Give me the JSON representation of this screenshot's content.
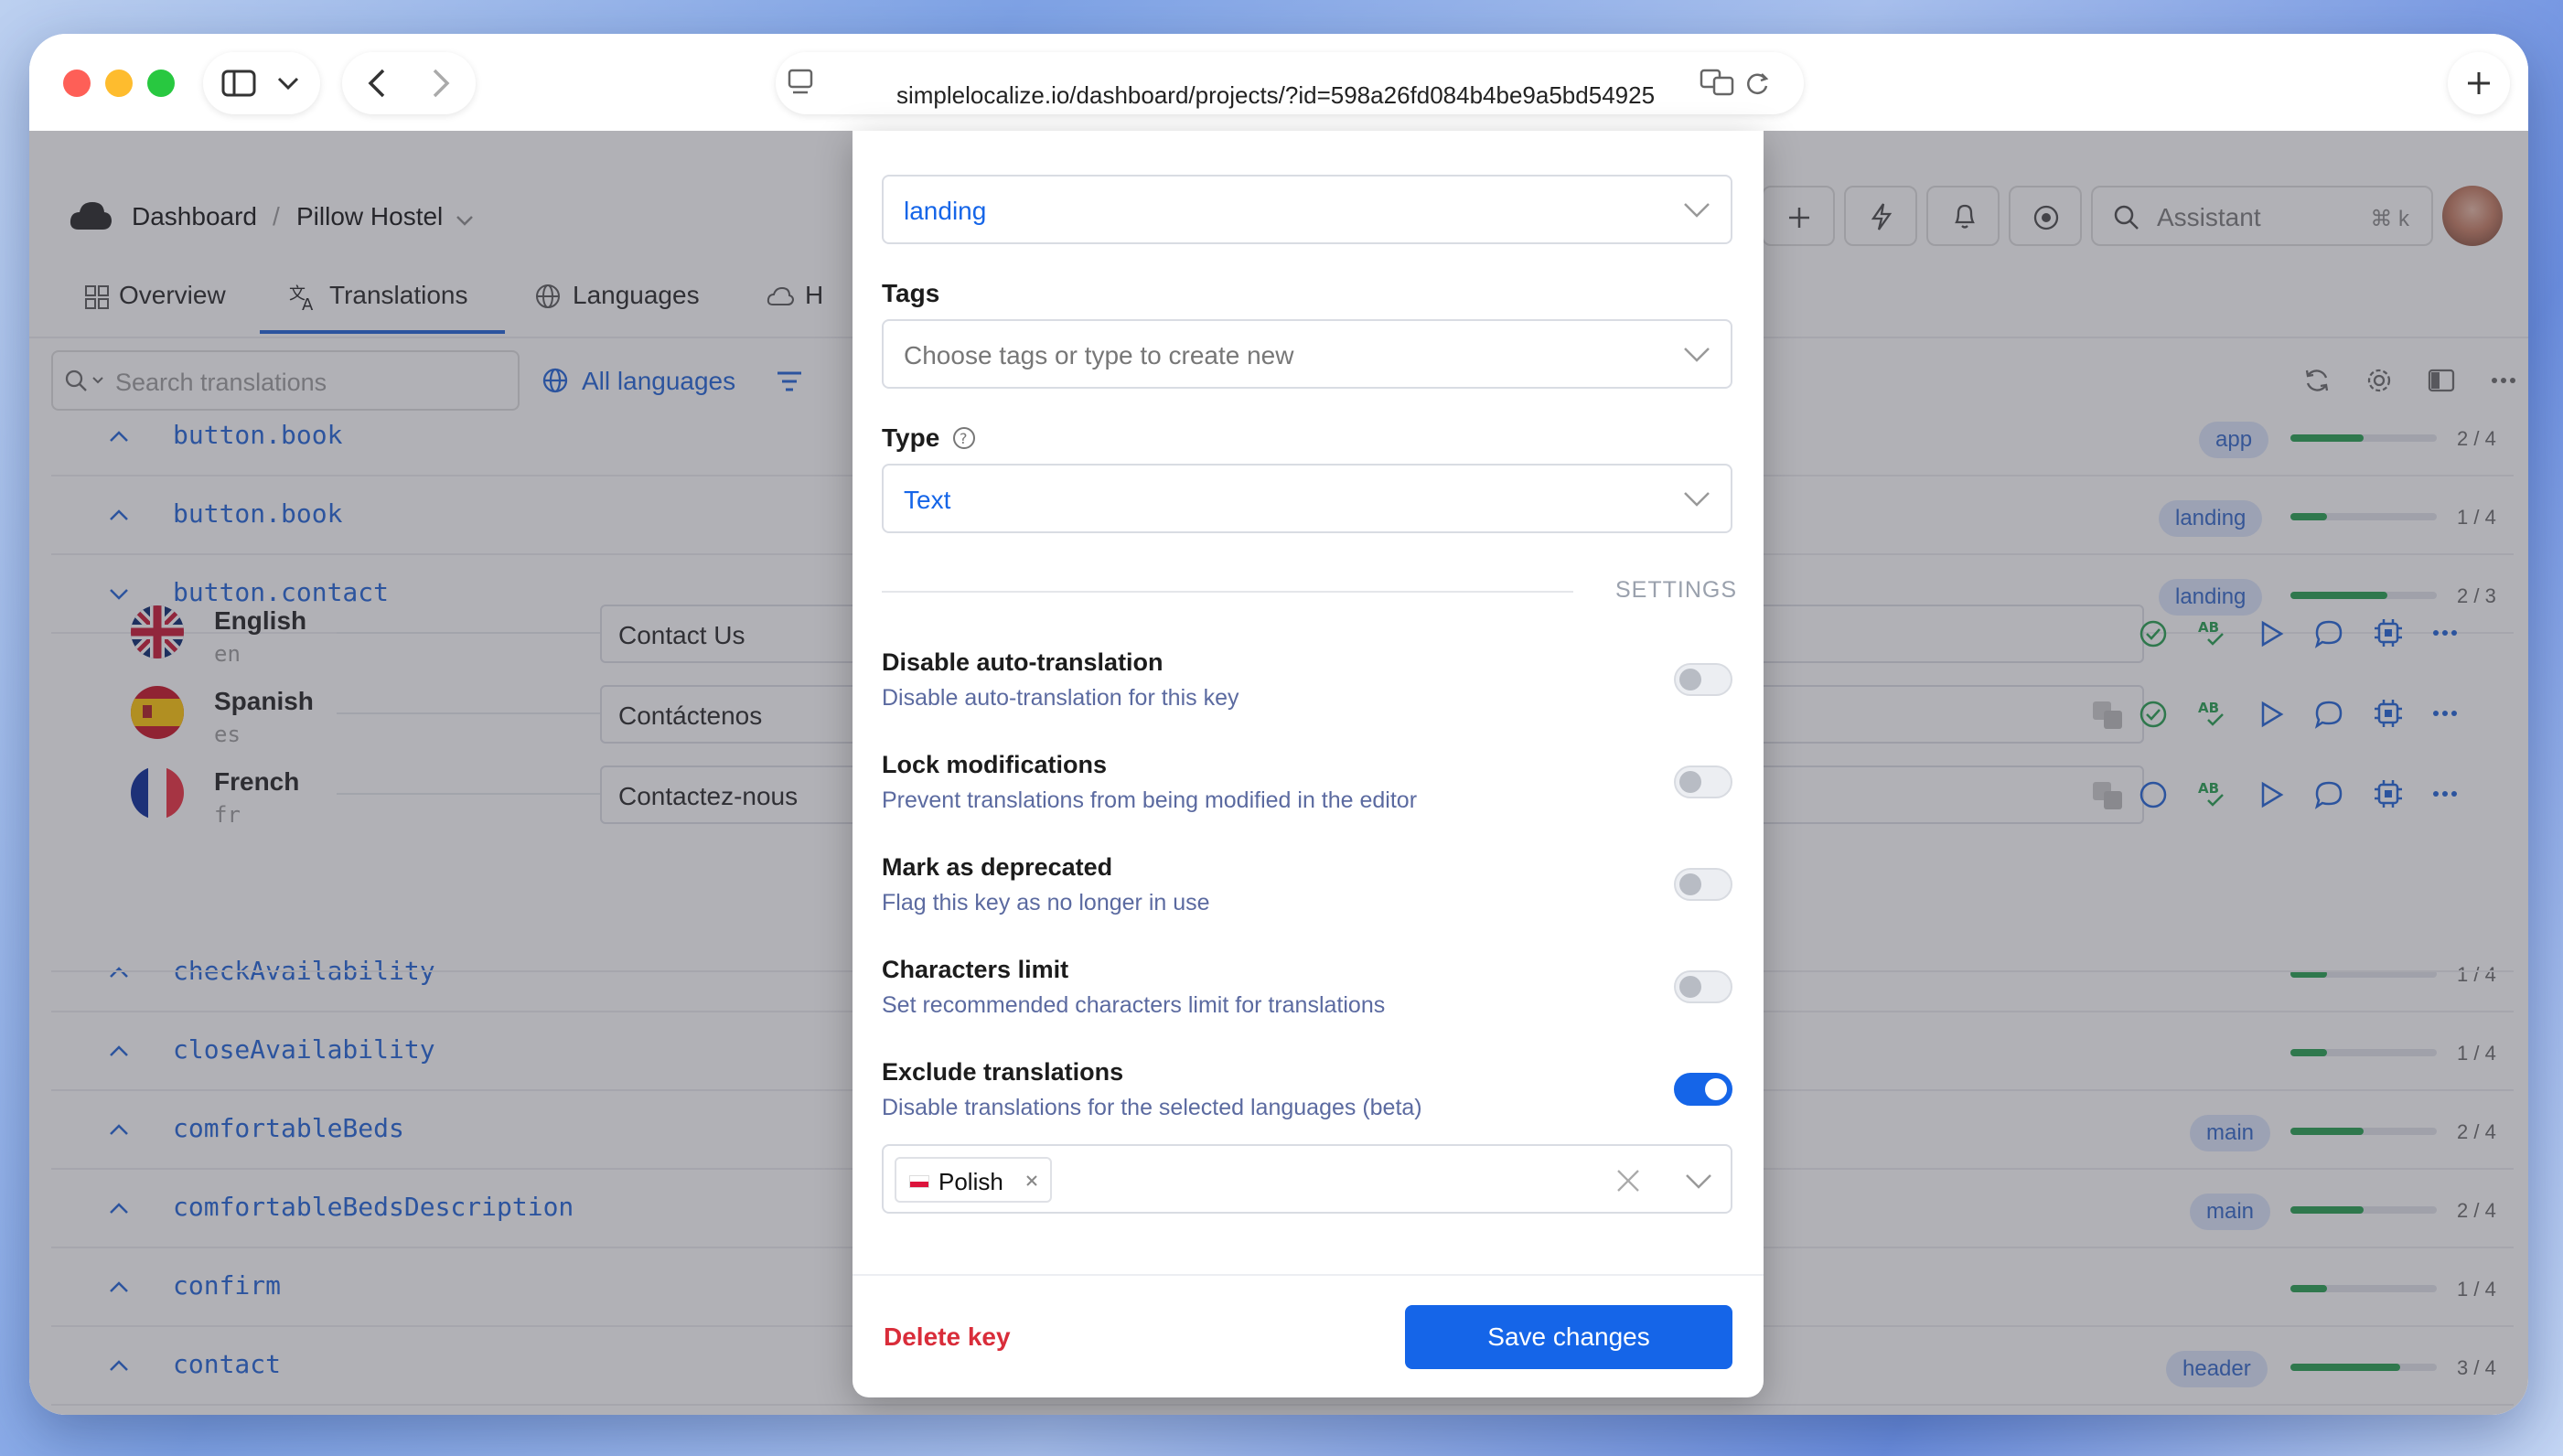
{
  "browser": {
    "url": "simplelocalize.io/dashboard/projects/?id=598a26fd084b4be9a5bd54925"
  },
  "header": {
    "breadcrumb_root": "Dashboard",
    "breadcrumb_sep": "/",
    "project": "Pillow Hostel",
    "assistant": "Assistant",
    "shortcut": "⌘ k"
  },
  "tabs": [
    "Overview",
    "Translations",
    "Languages",
    "H"
  ],
  "toolbar": {
    "search_placeholder": "Search translations",
    "all_languages": "All languages"
  },
  "keys": [
    {
      "key": "button.book",
      "tag": "app",
      "count": "2 / 4",
      "progress": 0.5
    },
    {
      "key": "button.book",
      "tag": "landing",
      "count": "1 / 4",
      "progress": 0.25
    },
    {
      "key": "button.contact",
      "tag": "landing",
      "count": "2 / 3",
      "progress": 0.66
    },
    {
      "key": "checkAvailability",
      "tag": "",
      "count": "1 / 4",
      "progress": 0.25
    },
    {
      "key": "closeAvailability",
      "tag": "",
      "count": "1 / 4",
      "progress": 0.25
    },
    {
      "key": "comfortableBeds",
      "tag": "main",
      "count": "2 / 4",
      "progress": 0.5
    },
    {
      "key": "comfortableBedsDescription",
      "tag": "main",
      "count": "2 / 4",
      "progress": 0.5
    },
    {
      "key": "confirm",
      "tag": "",
      "count": "1 / 4",
      "progress": 0.25
    },
    {
      "key": "contact",
      "tag": "header",
      "count": "3 / 4",
      "progress": 0.75
    }
  ],
  "languages": [
    {
      "name": "English",
      "code": "en",
      "value": "Contact Us"
    },
    {
      "name": "Spanish",
      "code": "es",
      "value": "Contáctenos"
    },
    {
      "name": "French",
      "code": "fr",
      "value": "Contactez-nous"
    }
  ],
  "modal": {
    "namespace_value": "landing",
    "tags_label": "Tags",
    "tags_placeholder": "Choose tags or type to create new",
    "type_label": "Type",
    "type_value": "Text",
    "settings_heading": "SETTINGS",
    "options": [
      {
        "title": "Disable auto-translation",
        "desc": "Disable auto-translation for this key",
        "enabled": false
      },
      {
        "title": "Lock modifications",
        "desc": "Prevent translations from being modified in the editor",
        "enabled": false
      },
      {
        "title": "Mark as deprecated",
        "desc": "Flag this key as no longer in use",
        "enabled": false
      },
      {
        "title": "Characters limit",
        "desc": "Set recommended characters limit for translations",
        "enabled": false
      },
      {
        "title": "Exclude translations",
        "desc": "Disable translations for the selected languages (beta)",
        "enabled": true
      }
    ],
    "excluded_language": "Polish",
    "delete_label": "Delete key",
    "save_label": "Save changes"
  },
  "colors": {
    "accent": "#1565e8",
    "danger": "#d92d3a",
    "progress": "#1f9e4a"
  }
}
